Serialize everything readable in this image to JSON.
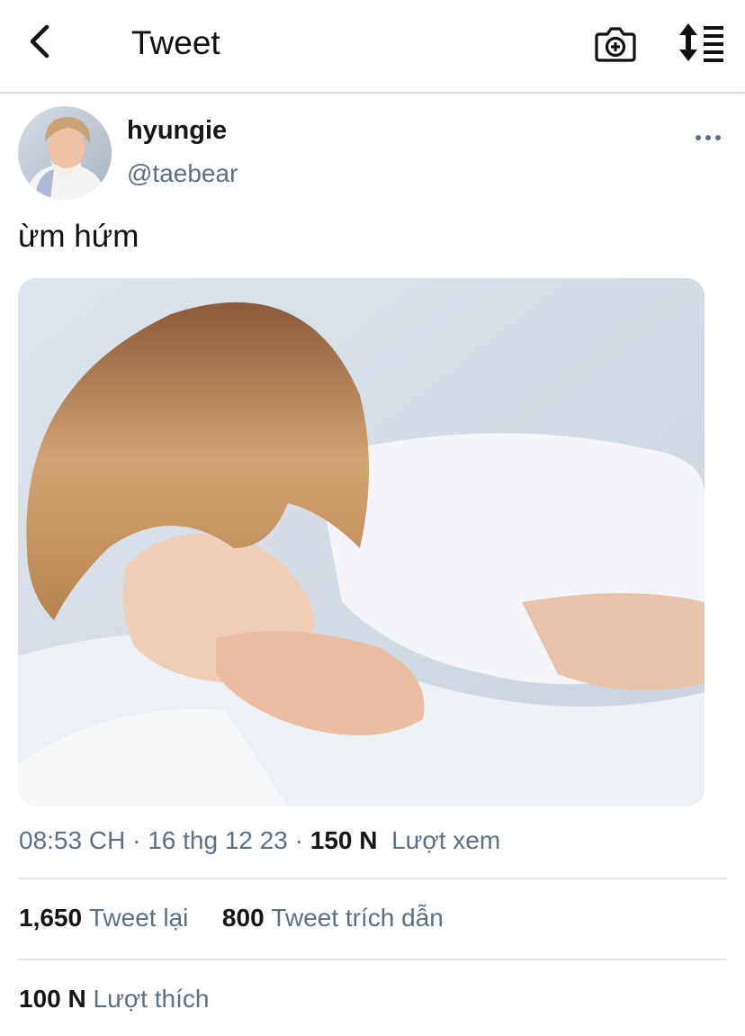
{
  "header": {
    "title": "Tweet",
    "back_icon": "chevron-left-icon",
    "camera_icon": "camera-plus-icon",
    "sort_icon": "sort-list-icon"
  },
  "tweet": {
    "author_name": "hyungie",
    "author_handle": "@taebear",
    "text": "ừm hứm",
    "time": "08:53 CH",
    "date": "16 thg 12 23",
    "views_count": "150 N",
    "views_label": "Lượt xem",
    "more_icon": "more-horizontal-icon"
  },
  "stats": {
    "retweets_count": "1,650",
    "retweets_label": "Tweet lại",
    "quotes_count": "800",
    "quotes_label": "Tweet trích dẫn",
    "likes_count": "100 N",
    "likes_label": "Lượt thích"
  },
  "colors": {
    "secondary_text": "#5b7083",
    "primary_text": "#151515",
    "divider": "#e6e6e6"
  }
}
